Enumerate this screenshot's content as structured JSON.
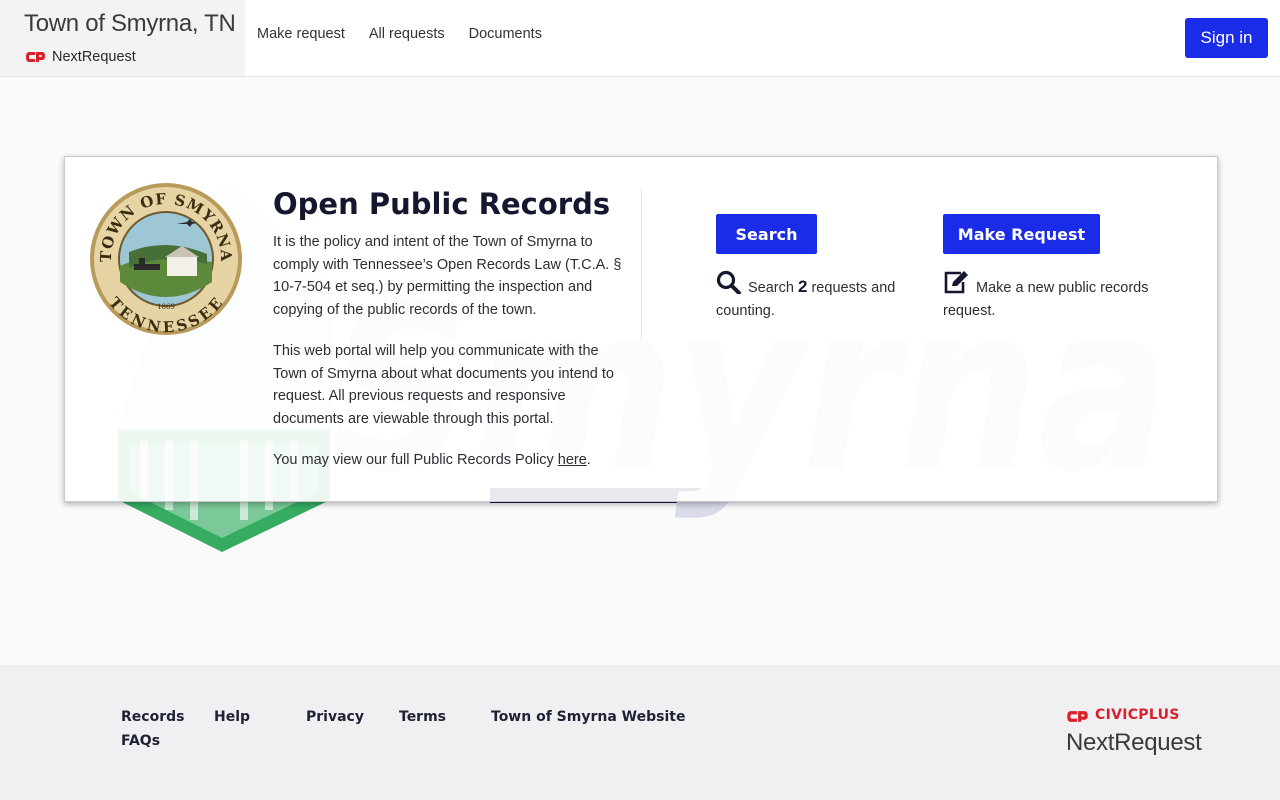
{
  "header": {
    "title": "Town of Smyrna, TN",
    "product": "NextRequest",
    "nav": [
      "Make request",
      "All requests",
      "Documents"
    ],
    "sign_in": "Sign in"
  },
  "card": {
    "seal_text_top": "TOWN OF SMYRNA",
    "seal_text_bottom": "TENNESSEE",
    "seal_year": "1869",
    "title": "Open Public Records",
    "para1": "It is the policy and intent of the Town of Smyrna to comply with Tennessee’s Open Records Law (T.C.A. § 10-7-504 et seq.) by permitting the inspection and copying of the public records of the town.",
    "para2": "This web portal will help you communicate with the Town of Smyrna about what documents you intend to request. All previous requests and responsive documents are viewable through this portal.",
    "para3_prefix": "You may view our full Public Records Policy ",
    "para3_link": "here",
    "para3_suffix": "."
  },
  "actions": {
    "search": {
      "button": "Search",
      "prefix": "Search ",
      "count": "2",
      "suffix": " requests and counting.",
      "icon": "search-icon"
    },
    "make_request": {
      "button": "Make Request",
      "desc": "Make a new public records request.",
      "icon": "edit-icon"
    }
  },
  "background": {
    "watermark": "Smyrna"
  },
  "footer": {
    "links": [
      "Records",
      "Help",
      "Privacy",
      "Terms",
      "Town of Smyrna Website",
      "FAQs"
    ],
    "logo_brand": "CIVICPLUS",
    "logo_product": "NextRequest"
  },
  "colors": {
    "primary": "#1a2ce8",
    "civicplus_red": "#d91f2a",
    "watermark": "#d9dbeb",
    "green": "#2aa85a"
  }
}
